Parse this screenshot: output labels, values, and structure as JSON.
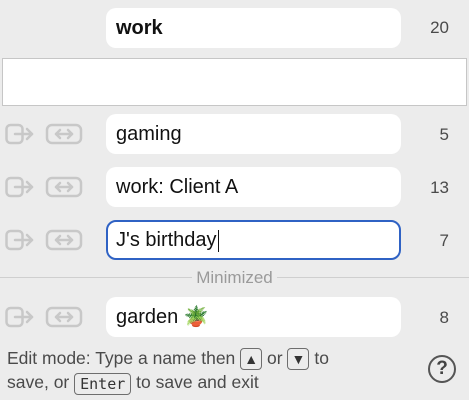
{
  "spaces": [
    {
      "name": "work",
      "count": "20",
      "current": true
    },
    {
      "name": "gaming",
      "count": "5"
    },
    {
      "name": "work: Client A",
      "count": "13"
    },
    {
      "name": "J's birthday",
      "count": "7",
      "editing": true
    }
  ],
  "new_space": {
    "value": "",
    "placeholder": ""
  },
  "minimized": {
    "label": "Minimized",
    "spaces": [
      {
        "name": "garden 🪴",
        "count": "8"
      }
    ]
  },
  "footer": {
    "part1": "Edit mode: Type a name then",
    "up_key": "▲",
    "or": "or",
    "down_key": "▼",
    "part2": "to",
    "part3": "save, or",
    "enter_key": "Enter",
    "part4": "to save and exit",
    "help": "?"
  },
  "icons": {
    "open": "arrow-into-box-icon",
    "move": "link-arrows-icon",
    "help": "help-icon"
  },
  "colors": {
    "background": "#ececec",
    "field": "#ffffff",
    "focus_border": "#2f62c4",
    "icon_faded": "#c8c8c8",
    "muted_text": "#9a9a9a"
  }
}
